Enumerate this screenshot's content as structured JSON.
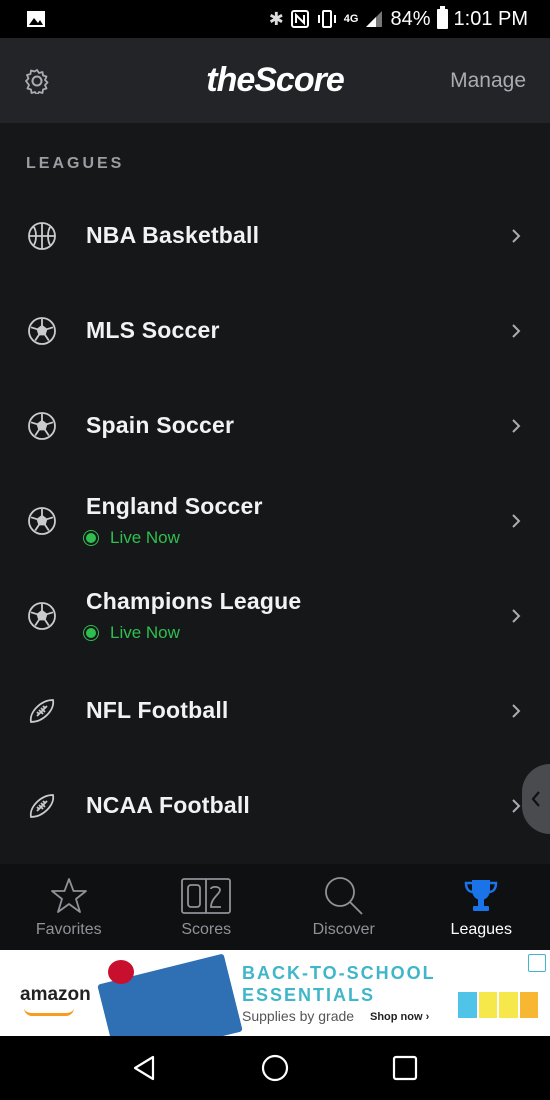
{
  "status_bar": {
    "battery": "84%",
    "time": "1:01 PM",
    "network": "4G"
  },
  "header": {
    "logo": "theScore",
    "manage_label": "Manage"
  },
  "section": {
    "title": "LEAGUES"
  },
  "leagues": [
    {
      "name": "NBA Basketball",
      "icon": "basketball-icon",
      "live": ""
    },
    {
      "name": "MLS Soccer",
      "icon": "soccer-ball-icon",
      "live": ""
    },
    {
      "name": "Spain Soccer",
      "icon": "soccer-ball-icon",
      "live": ""
    },
    {
      "name": "England Soccer",
      "icon": "soccer-ball-icon",
      "live": "Live Now"
    },
    {
      "name": "Champions League",
      "icon": "soccer-ball-icon",
      "live": "Live Now"
    },
    {
      "name": "NFL Football",
      "icon": "football-icon",
      "live": ""
    },
    {
      "name": "NCAA Football",
      "icon": "football-icon",
      "live": ""
    }
  ],
  "bottom_nav": [
    {
      "label": "Favorites",
      "icon": "star-icon"
    },
    {
      "label": "Scores",
      "icon": "scoreboard-icon"
    },
    {
      "label": "Discover",
      "icon": "search-icon"
    },
    {
      "label": "Leagues",
      "icon": "trophy-icon",
      "active": true
    }
  ],
  "ad": {
    "brand": "amazon",
    "headline_line1": "BACK-TO-SCHOOL",
    "headline_line2": "ESSENTIALS",
    "subtext": "Supplies by grade",
    "cta": "Shop now ›"
  },
  "colors": {
    "background": "#161719",
    "header": "#232427",
    "live_green": "#2fbf4f",
    "active_blue": "#1a73e8"
  }
}
